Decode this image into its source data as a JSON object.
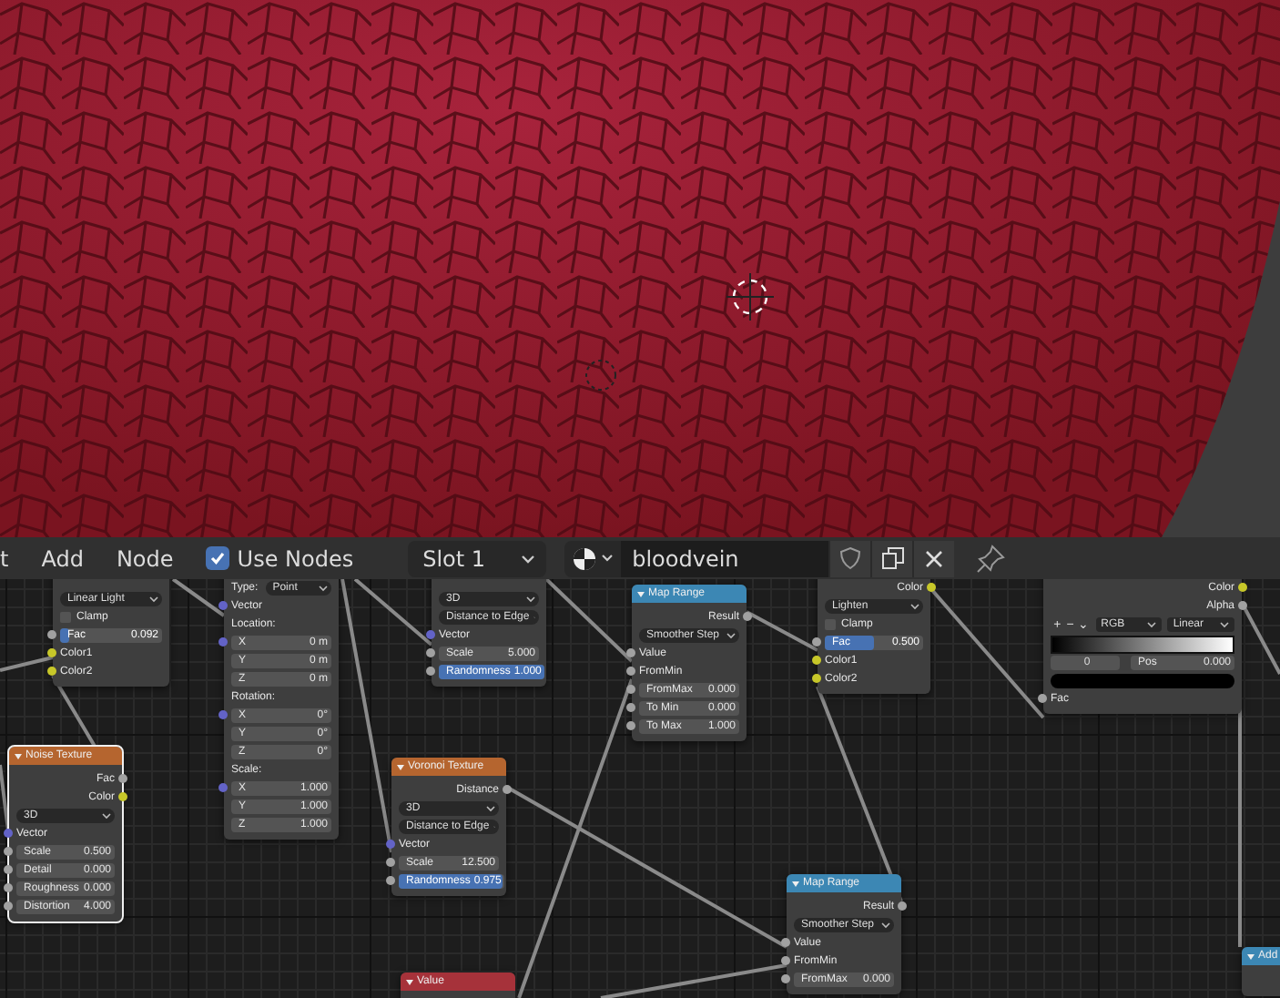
{
  "header": {
    "menus": [
      "t",
      "Add",
      "Node"
    ],
    "use_nodes": {
      "label": "Use Nodes",
      "checked": true
    },
    "slot": "Slot 1",
    "material": "bloodvein"
  },
  "nodes": [
    {
      "rows": [
        {
          "kind": "dropdown",
          "value": "Linear Light"
        },
        {
          "kind": "checkbox",
          "label": "Clamp",
          "checked": false
        },
        {
          "kind": "slider",
          "label": "Fac",
          "value": "0.092",
          "level": 0.092,
          "socket": {
            "color": "#a1a1a1"
          }
        },
        {
          "kind": "input",
          "label": "Color1",
          "socket": {
            "color": "#c7c729"
          }
        },
        {
          "kind": "input",
          "label": "Color2",
          "socket": {
            "color": "#c7c729"
          }
        }
      ]
    },
    {
      "rows": [
        {
          "kind": "dropdown",
          "label": "Type:",
          "value": "Point"
        },
        {
          "kind": "input",
          "label": "Vector",
          "socket": {
            "color": "#6363c7"
          }
        },
        {
          "kind": "heading",
          "label": "Location:"
        },
        {
          "kind": "field",
          "label": "X",
          "value": "0 m",
          "socket": {
            "color": "#6363c7"
          }
        },
        {
          "kind": "field",
          "label": "Y",
          "value": "0 m"
        },
        {
          "kind": "field",
          "label": "Z",
          "value": "0 m"
        },
        {
          "kind": "heading",
          "label": "Rotation:"
        },
        {
          "kind": "field",
          "label": "X",
          "value": "0°",
          "socket": {
            "color": "#6363c7"
          }
        },
        {
          "kind": "field",
          "label": "Y",
          "value": "0°"
        },
        {
          "kind": "field",
          "label": "Z",
          "value": "0°"
        },
        {
          "kind": "heading",
          "label": "Scale:"
        },
        {
          "kind": "field",
          "label": "X",
          "value": "1.000",
          "socket": {
            "color": "#6363c7"
          }
        },
        {
          "kind": "field",
          "label": "Y",
          "value": "1.000"
        },
        {
          "kind": "field",
          "label": "Z",
          "value": "1.000"
        }
      ]
    },
    {
      "title": "Noise Texture",
      "color": "#b5652f",
      "selected": true,
      "rows": [
        {
          "kind": "output",
          "label": "Fac",
          "socket": {
            "color": "#a1a1a1"
          }
        },
        {
          "kind": "output",
          "label": "Color",
          "socket": {
            "color": "#c7c729"
          }
        },
        {
          "kind": "dropdown",
          "value": "3D"
        },
        {
          "kind": "input",
          "label": "Vector",
          "socket": {
            "color": "#6363c7"
          }
        },
        {
          "kind": "field",
          "label": "Scale",
          "value": "0.500",
          "socket": {
            "color": "#a1a1a1"
          }
        },
        {
          "kind": "field",
          "label": "Detail",
          "value": "0.000",
          "socket": {
            "color": "#a1a1a1"
          }
        },
        {
          "kind": "field",
          "label": "Roughness",
          "value": "0.000",
          "socket": {
            "color": "#a1a1a1"
          }
        },
        {
          "kind": "field",
          "label": "Distortion",
          "value": "4.000",
          "socket": {
            "color": "#a1a1a1"
          }
        }
      ]
    },
    {
      "rows": [
        {
          "kind": "dropdown",
          "value": "3D"
        },
        {
          "kind": "dropdown",
          "value": "Distance to Edge"
        },
        {
          "kind": "input",
          "label": "Vector",
          "socket": {
            "color": "#6363c7"
          }
        },
        {
          "kind": "field",
          "label": "Scale",
          "value": "5.000",
          "socket": {
            "color": "#a1a1a1"
          }
        },
        {
          "kind": "slider",
          "label": "Randomness",
          "value": "1.000",
          "level": 1,
          "socket": {
            "color": "#a1a1a1"
          }
        }
      ]
    },
    {
      "title": "Voronoi Texture",
      "color": "#b5652f",
      "selected": false,
      "rows": [
        {
          "kind": "output",
          "label": "Distance",
          "socket": {
            "color": "#a1a1a1"
          }
        },
        {
          "kind": "dropdown",
          "value": "3D"
        },
        {
          "kind": "dropdown",
          "value": "Distance to Edge"
        },
        {
          "kind": "input",
          "label": "Vector",
          "socket": {
            "color": "#6363c7"
          }
        },
        {
          "kind": "field",
          "label": "Scale",
          "value": "12.500",
          "socket": {
            "color": "#a1a1a1"
          }
        },
        {
          "kind": "slider",
          "label": "Randomness",
          "value": "0.975",
          "level": 0.975,
          "socket": {
            "color": "#a1a1a1"
          }
        }
      ]
    },
    {
      "title": "Map Range",
      "color": "#3c87b4",
      "selected": false,
      "rows": [
        {
          "kind": "output",
          "label": "Result",
          "socket": {
            "color": "#a1a1a1"
          }
        },
        {
          "kind": "dropdown",
          "value": "Smoother Step"
        },
        {
          "kind": "input",
          "label": "Value",
          "socket": {
            "color": "#a1a1a1"
          }
        },
        {
          "kind": "input",
          "label": "FromMin",
          "socket": {
            "color": "#a1a1a1"
          }
        },
        {
          "kind": "field",
          "label": "FromMax",
          "value": "0.000",
          "socket": {
            "color": "#a1a1a1"
          }
        },
        {
          "kind": "field",
          "label": "To Min",
          "value": "0.000",
          "socket": {
            "color": "#a1a1a1"
          }
        },
        {
          "kind": "field",
          "label": "To Max",
          "value": "1.000",
          "socket": {
            "color": "#a1a1a1"
          }
        }
      ]
    },
    {
      "rows": [
        {
          "kind": "output",
          "label": "Color",
          "socket": {
            "color": "#c7c729"
          }
        },
        {
          "kind": "dropdown",
          "value": "Lighten"
        },
        {
          "kind": "checkbox",
          "label": "Clamp",
          "checked": false
        },
        {
          "kind": "slider",
          "label": "Fac",
          "value": "0.500",
          "level": 0.5,
          "socket": {
            "color": "#a1a1a1"
          }
        },
        {
          "kind": "input",
          "label": "Color1",
          "socket": {
            "color": "#c7c729"
          }
        },
        {
          "kind": "input",
          "label": "Color2",
          "socket": {
            "color": "#c7c729"
          }
        }
      ]
    },
    {
      "rows": [
        {
          "kind": "output",
          "label": "Color",
          "socket": {
            "color": "#c7c729"
          }
        },
        {
          "kind": "output",
          "label": "Alpha",
          "socket": {
            "color": "#a1a1a1"
          }
        },
        {
          "kind": "ramp_tools",
          "buttons": [
            "+",
            "−",
            "⌄"
          ],
          "mode": "RGB",
          "interpolation": "Linear"
        },
        {
          "kind": "ramp"
        },
        {
          "kind": "ramp_stop",
          "index": "0",
          "label": "Pos",
          "value": "0.000"
        },
        {
          "kind": "swatch",
          "color": "#000000"
        },
        {
          "kind": "input",
          "label": "Fac",
          "socket": {
            "color": "#a1a1a1"
          }
        }
      ]
    },
    {
      "title": "Value",
      "color": "#a6323a",
      "selected": false
    },
    {
      "title": "Map Range",
      "color": "#3c87b4",
      "selected": false,
      "rows": [
        {
          "kind": "output",
          "label": "Result",
          "socket": {
            "color": "#a1a1a1"
          }
        },
        {
          "kind": "dropdown",
          "value": "Smoother Step"
        },
        {
          "kind": "input",
          "label": "Value",
          "socket": {
            "color": "#a1a1a1"
          }
        },
        {
          "kind": "input",
          "label": "FromMin",
          "socket": {
            "color": "#a1a1a1"
          }
        },
        {
          "kind": "field",
          "label": "FromMax",
          "value": "0.000",
          "socket": {
            "color": "#a1a1a1"
          }
        }
      ]
    },
    {
      "title": "Add",
      "color": "#3c87b4",
      "selected": false
    }
  ]
}
